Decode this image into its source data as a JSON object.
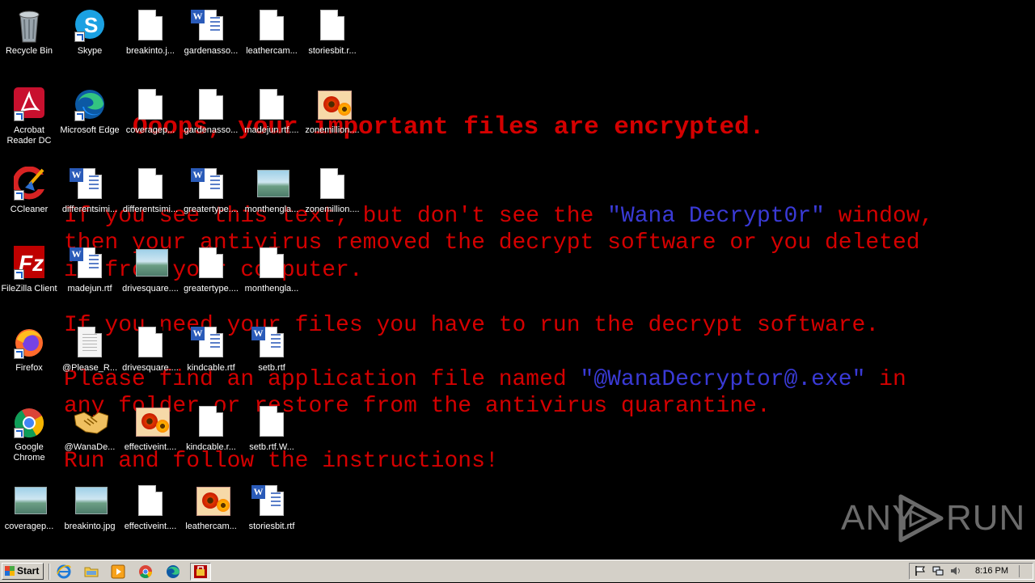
{
  "note": {
    "title": "Ooops, your important files are encrypted.",
    "line1_a": "If you see this text, but don't see the ",
    "line1_b": "\"Wana Decrypt0r\"",
    "line1_c": " window,",
    "line2": "then your antivirus removed the decrypt software or you deleted",
    "line3": "it from your computer.",
    "line4": "If you need your files you have to run the decrypt software.",
    "line5_a": "Please find an application file named ",
    "line5_b": "\"@WanaDecryptor@.exe\"",
    "line5_c": " in",
    "line6": "any folder or restore from the antivirus quarantine.",
    "line7": "Run and follow the instructions!"
  },
  "desktop": {
    "icons": {
      "recycle_bin": "Recycle Bin",
      "skype": "Skype",
      "breakinto_j": "breakinto.j...",
      "gardenasso_1": "gardenasso...",
      "leathercam_1": "leathercam...",
      "storiesbit_r": "storiesbit.r...",
      "acrobat": "Acrobat Reader DC",
      "edge": "Microsoft Edge",
      "coveragep_1": "coveragep...",
      "gardenasso_2": "gardenasso...",
      "madejun_rtf": "madejun.rtf....",
      "zonemillion_1": "zonemillion....",
      "ccleaner": "CCleaner",
      "differentsimi_1": "differentsimi...",
      "differentsimi_2": "differentsimi...",
      "greatertype_1": "greatertype....",
      "monthengla_1": "monthengla...",
      "zonemillion_2": "zonemillion....",
      "filezilla": "FileZilla Client",
      "madejun": "madejun.rtf",
      "drivesquare_1": "drivesquare....",
      "greatertype_2": "greatertype....",
      "monthengla_2": "monthengla...",
      "firefox": "Firefox",
      "please_r": "@Please_R...",
      "drivesquare_2": "drivesquare....",
      "kindcable_rtf": "kindcable.rtf",
      "setb_rtf": "setb.rtf",
      "chrome": "Google Chrome",
      "wanade": "@WanaDe...",
      "effectiveint_1": "effectiveint....",
      "kindcable_r": "kindcable.r...",
      "setb_rtf_w": "setb.rtf.W...",
      "coveragep_2": "coveragep...",
      "breakinto_jpg": "breakinto.jpg",
      "effectiveint_2": "effectiveint....",
      "leathercam_2": "leathercam...",
      "storiesbit_rtf": "storiesbit.rtf"
    }
  },
  "taskbar": {
    "start_label": "Start",
    "clock": "8:16 PM",
    "pinned": [
      "internet-explorer-icon",
      "folder-icon",
      "media-player-icon",
      "chrome-icon",
      "edge-icon",
      "wanna-decryptor-icon"
    ]
  },
  "watermark": {
    "text_left": "ANY",
    "text_right": "RUN"
  },
  "colors": {
    "note_red": "#d40000",
    "note_blue": "#3a3ad6",
    "background": "#000000",
    "taskbar": "#d4d0c8"
  }
}
